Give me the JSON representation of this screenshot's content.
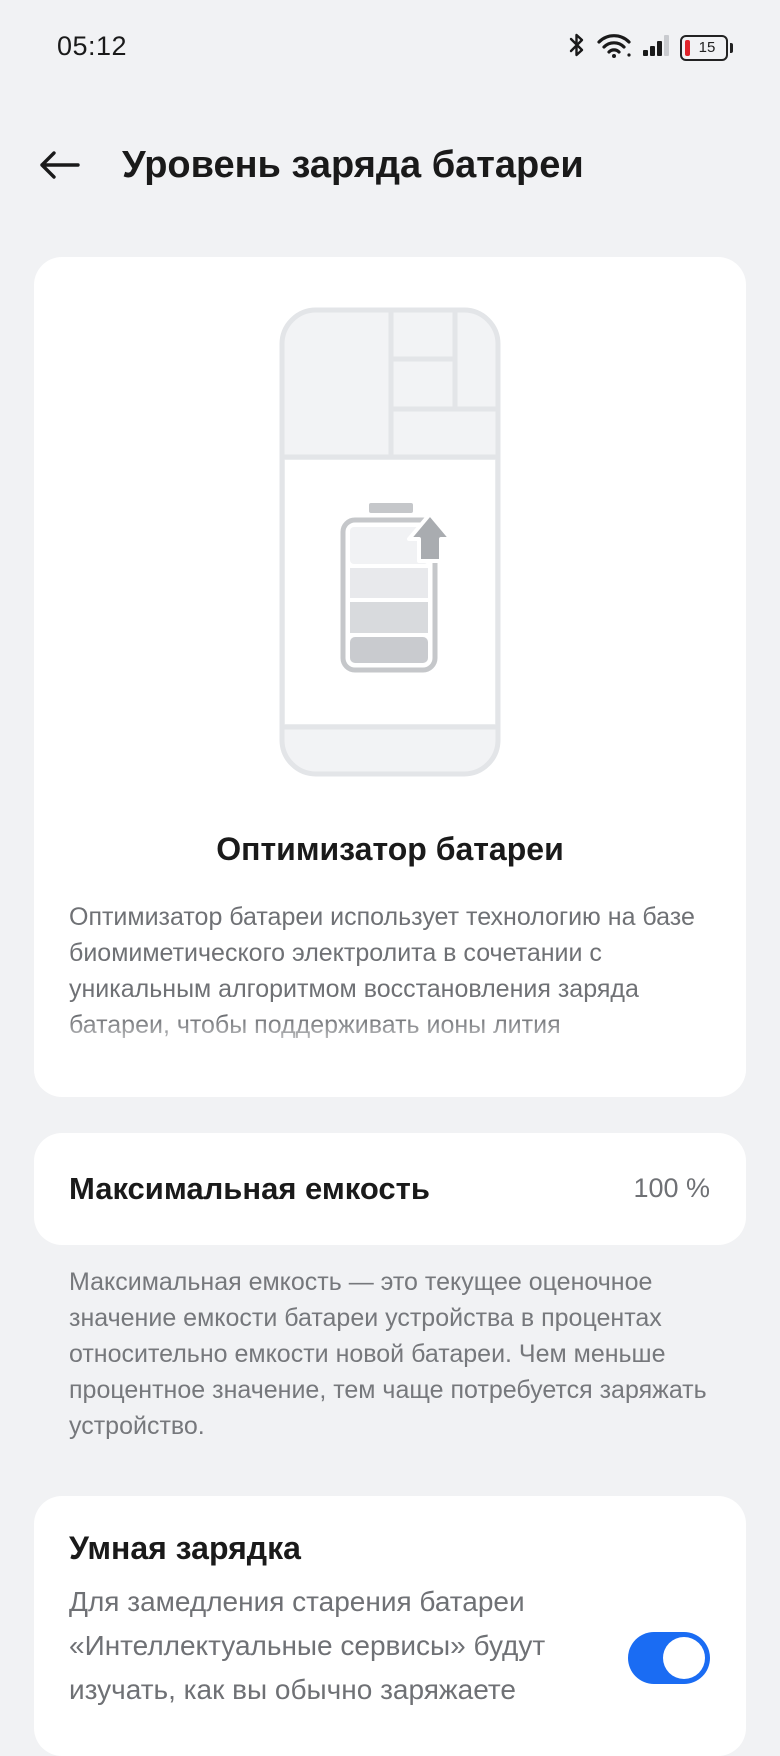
{
  "status_bar": {
    "time": "05:12",
    "battery_level": "15",
    "battery_level_color": "#e0242b"
  },
  "header": {
    "title": "Уровень заряда батареи"
  },
  "optimizer_card": {
    "title": "Оптимизатор батареи",
    "description": "Оптимизатор батареи использует технологию на базе биомиметического электролита в сочетании с уникальным алгоритмом восстановления заряда батареи, чтобы поддерживать ионы лития"
  },
  "capacity": {
    "label": "Максимальная емкость",
    "value": "100 %",
    "note": "Максимальная емкость — это текущее оценочное значение емкости батареи устройства в процентах относительно емкости новой батареи. Чем меньше процентное значение, тем чаще потребуется заряжать устройство."
  },
  "smart_charging": {
    "title": "Умная зарядка",
    "description": "Для замедления старения батареи «Интеллектуальные сервисы» будут изучать, как вы обычно заряжаете",
    "enabled": true,
    "accent_color": "#1a6cf3"
  }
}
